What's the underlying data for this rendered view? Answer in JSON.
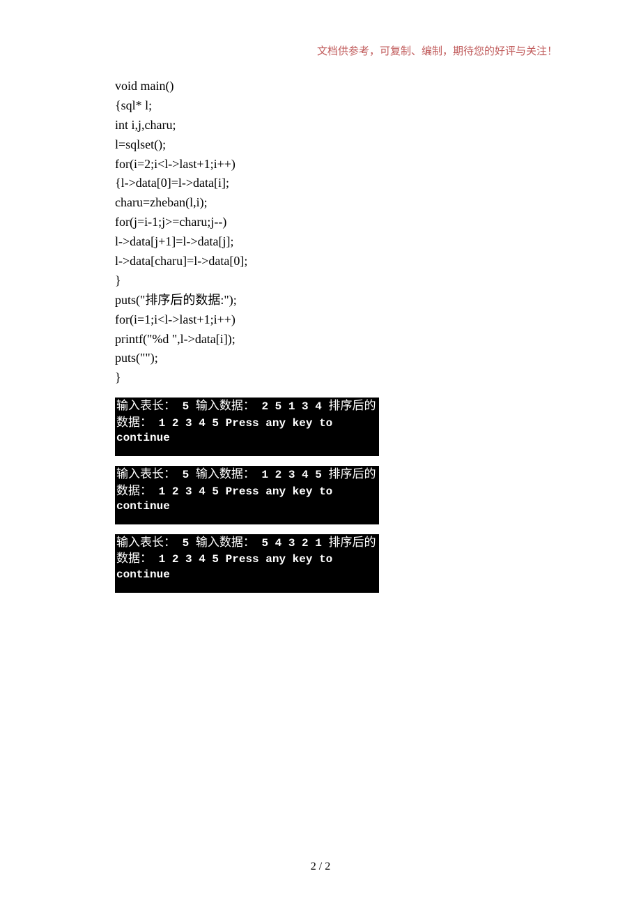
{
  "header": {
    "note": "文档供参考，可复制、编制，期待您的好评与关注！"
  },
  "code": {
    "lines": [
      "void main()",
      "{sql* l;",
      "int i,j,charu;",
      "l=sqlset();",
      "for(i=2;i<l->last+1;i++)",
      "{l->data[0]=l->data[i];",
      "charu=zheban(l,i);",
      "for(j=i-1;j>=charu;j--)",
      "l->data[j+1]=l->data[j];",
      "l->data[charu]=l->data[0];",
      "}",
      "puts(\"排序后的数据:\");",
      "for(i=1;i<l->last+1;i++)",
      "printf(\"%d \",l->data[i]);",
      "puts(\"\");",
      "}"
    ]
  },
  "terminals": [
    {
      "prompt_len": "输入表长：",
      "len": "5",
      "prompt_data": "输入数据：",
      "data": "2 5 1 3 4",
      "result_label": "排序后的数据：",
      "result": "1 2 3 4 5",
      "continue": "Press any key to continue"
    },
    {
      "prompt_len": "输入表长：",
      "len": "5",
      "prompt_data": "输入数据：",
      "data": "1 2 3 4 5",
      "result_label": "排序后的数据：",
      "result": "1 2 3 4 5",
      "continue": "Press any key to continue"
    },
    {
      "prompt_len": "输入表长：",
      "len": "5",
      "prompt_data": "输入数据：",
      "data": "5 4 3 2 1",
      "result_label": "排序后的数据：",
      "result": "1 2 3 4 5",
      "continue": "Press any key to continue"
    }
  ],
  "footer": {
    "page_num": "2 / 2"
  }
}
